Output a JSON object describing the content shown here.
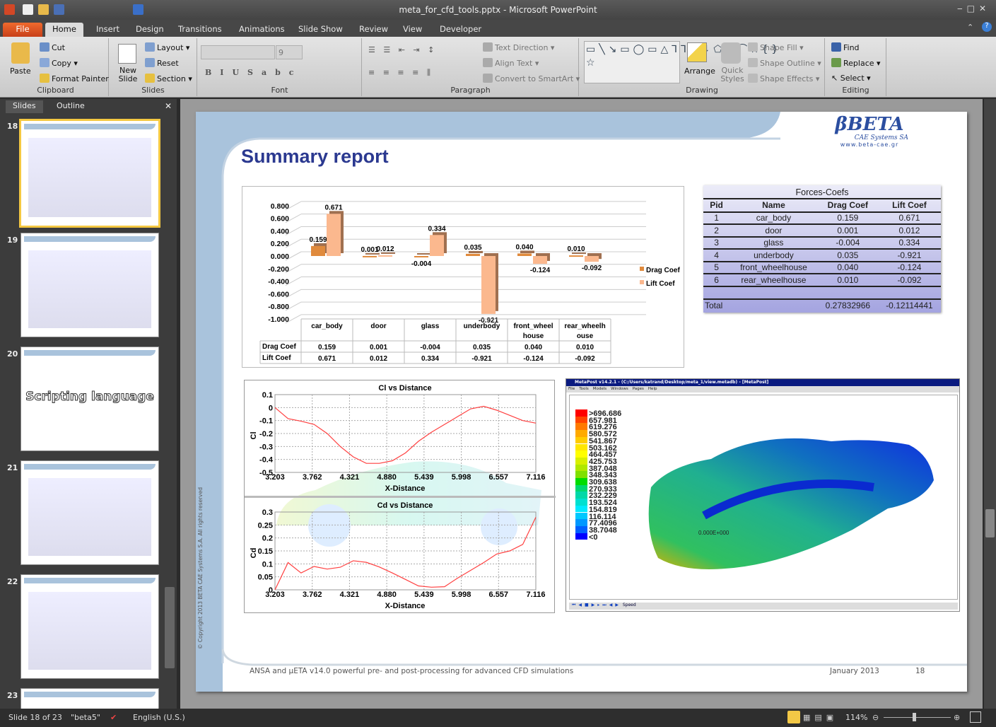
{
  "window": {
    "title": "meta_for_cfd_tools.pptx - Microsoft PowerPoint"
  },
  "tabs": [
    "File",
    "Home",
    "Insert",
    "Design",
    "Transitions",
    "Animations",
    "Slide Show",
    "Review",
    "View",
    "Developer"
  ],
  "ribbon": {
    "clipboard": {
      "label": "Clipboard",
      "paste": "Paste",
      "cut": "Cut",
      "copy": "Copy",
      "format_painter": "Format Painter"
    },
    "slides": {
      "label": "Slides",
      "new_slide": "New Slide",
      "layout": "Layout",
      "reset": "Reset",
      "section": "Section"
    },
    "font": {
      "label": "Font",
      "size": "9"
    },
    "paragraph": {
      "label": "Paragraph",
      "text_direction": "Text Direction",
      "align_text": "Align Text",
      "convert": "Convert to SmartArt"
    },
    "drawing": {
      "label": "Drawing",
      "arrange": "Arrange",
      "quick_styles": "Quick Styles",
      "shape_fill": "Shape Fill",
      "shape_outline": "Shape Outline",
      "shape_effects": "Shape Effects"
    },
    "editing": {
      "label": "Editing",
      "find": "Find",
      "replace": "Replace",
      "select": "Select"
    }
  },
  "pane": {
    "tabs": [
      "Slides",
      "Outline"
    ],
    "thumbs": [
      {
        "num": "18"
      },
      {
        "num": "19"
      },
      {
        "num": "20",
        "text": "Scripting language"
      },
      {
        "num": "21"
      },
      {
        "num": "22"
      },
      {
        "num": "23"
      }
    ]
  },
  "slide": {
    "title": "Summary report",
    "logo": {
      "brand": "βBETA",
      "sub": "CAE Systems SA",
      "url": "www.beta-cae.gr"
    },
    "copyright": "© Copyright 2013 BETA CAE Systems S.A. All rights reserved",
    "footer": {
      "text": "ANSA and μETA v14.0  powerful pre- and post-processing for advanced CFD simulations",
      "date": "January 2013",
      "page": "18"
    },
    "forces_table": {
      "title": "Forces-Coefs",
      "headers": [
        "Pid",
        "Name",
        "Drag Coef",
        "Lift Coef"
      ],
      "rows": [
        [
          "1",
          "car_body",
          "0.159",
          "0.671"
        ],
        [
          "2",
          "door",
          "0.001",
          "0.012"
        ],
        [
          "3",
          "glass",
          "-0.004",
          "0.334"
        ],
        [
          "4",
          "underbody",
          "0.035",
          "-0.921"
        ],
        [
          "5",
          "front_wheelhouse",
          "0.040",
          "-0.124"
        ],
        [
          "6",
          "rear_wheelhouse",
          "0.010",
          "-0.092"
        ]
      ],
      "total": [
        "Total",
        "",
        "0.27832966",
        "-0.12114441"
      ]
    },
    "metapost": {
      "title": "MetaPost v14.2.1 - (C:/Users/katrand/Desktop/meta_1/view.metadb) - [MetaPost]",
      "menu": [
        "File",
        "Tools",
        "Models",
        "Windows",
        "Pages",
        "Help"
      ],
      "legend": [
        ">696.686",
        "657.981",
        "619.276",
        "580.572",
        "541.867",
        "503.162",
        "464.457",
        "425.753",
        "387.048",
        "348.343",
        "309.638",
        "270.933",
        "232.229",
        "193.524",
        "154.819",
        "116.114",
        "77.4096",
        "38.7048",
        "<0"
      ],
      "legend_colors": [
        "#ff0000",
        "#ff4400",
        "#ff7a00",
        "#ffaa00",
        "#ffcc00",
        "#ffe600",
        "#ffff00",
        "#d8f000",
        "#b0e800",
        "#80e000",
        "#00dd00",
        "#00d870",
        "#00d8a8",
        "#00e0d0",
        "#00eaff",
        "#00c8ff",
        "#0098ff",
        "#0060ff",
        "#0000ff"
      ],
      "probe": "0.000E+000",
      "speed": "Speed"
    }
  },
  "chart_data": [
    {
      "type": "bar",
      "categories": [
        "car_body",
        "door",
        "glass",
        "underbody",
        "front_wheel house",
        "rear_wheelh ouse"
      ],
      "series": [
        {
          "name": "Drag Coef",
          "values": [
            0.159,
            0.001,
            -0.004,
            0.035,
            0.04,
            0.01
          ],
          "color": "#e08a3c"
        },
        {
          "name": "Lift Coef",
          "values": [
            0.671,
            0.012,
            0.334,
            -0.921,
            -0.124,
            -0.092
          ],
          "color": "#fbb88e"
        }
      ],
      "data_labels": [
        [
          "0.159",
          "0.001",
          "-0.004",
          "0.035",
          "0.040",
          "0.010"
        ],
        [
          "0.671",
          "0.012",
          "0.334",
          "-0.921",
          "-0.124",
          "-0.092"
        ]
      ],
      "yticks": [
        "0.800",
        "0.600",
        "0.400",
        "0.200",
        "0.000",
        "-0.200",
        "-0.400",
        "-0.600",
        "-0.800",
        "-1.000"
      ],
      "ylim": [
        -1.0,
        0.8
      ],
      "grid": true,
      "legend": "right",
      "data_table": true
    },
    {
      "type": "line",
      "title": "Cl vs Distance",
      "xlabel": "X-Distance",
      "ylabel": "Cl",
      "ylim": [
        -0.5,
        0.1
      ],
      "xticks": [
        "3.203",
        "3.762",
        "4.321",
        "4.880",
        "5.439",
        "5.998",
        "6.557",
        "7.116"
      ],
      "yticks": [
        "0.1",
        "0",
        "-0.1",
        "-0.2",
        "-0.3",
        "-0.4",
        "-0.5"
      ],
      "color": "#ff4040",
      "grid": true,
      "x": [
        3.203,
        3.399,
        3.594,
        3.79,
        3.986,
        4.182,
        4.377,
        4.573,
        4.768,
        4.964,
        5.16,
        5.355,
        5.551,
        5.747,
        5.942,
        6.138,
        6.334,
        6.529,
        6.725,
        6.92,
        7.116
      ],
      "y": [
        0,
        -0.085,
        -0.105,
        -0.13,
        -0.2,
        -0.3,
        -0.38,
        -0.43,
        -0.43,
        -0.41,
        -0.35,
        -0.26,
        -0.19,
        -0.13,
        -0.07,
        -0.01,
        0.01,
        -0.02,
        -0.06,
        -0.1,
        -0.12
      ]
    },
    {
      "type": "line",
      "title": "Cd vs Distance",
      "xlabel": "X-Distance",
      "ylabel": "Cd",
      "ylim": [
        0,
        0.3
      ],
      "xticks": [
        "3.203",
        "3.762",
        "4.321",
        "4.880",
        "5.439",
        "5.998",
        "6.557",
        "7.116"
      ],
      "yticks": [
        "0.3",
        "0.25",
        "0.2",
        "0.15",
        "0.1",
        "0.05",
        "0"
      ],
      "color": "#ff4040",
      "grid": true,
      "x": [
        3.203,
        3.399,
        3.594,
        3.79,
        3.986,
        4.182,
        4.377,
        4.573,
        4.768,
        4.964,
        5.16,
        5.355,
        5.551,
        5.747,
        5.942,
        6.138,
        6.334,
        6.529,
        6.725,
        6.92,
        7.116
      ],
      "y": [
        0,
        0.105,
        0.065,
        0.09,
        0.08,
        0.087,
        0.112,
        0.106,
        0.088,
        0.065,
        0.04,
        0.015,
        0.01,
        0.012,
        0.045,
        0.075,
        0.105,
        0.138,
        0.15,
        0.175,
        0.28
      ]
    }
  ],
  "status": {
    "slide": "Slide 18 of 23",
    "theme": "\"beta5\"",
    "language": "English (U.S.)",
    "zoom": "114%",
    "zoom_value": 114
  },
  "colors": {
    "accent": "#2b3990",
    "file_tab": "#d9531e"
  }
}
